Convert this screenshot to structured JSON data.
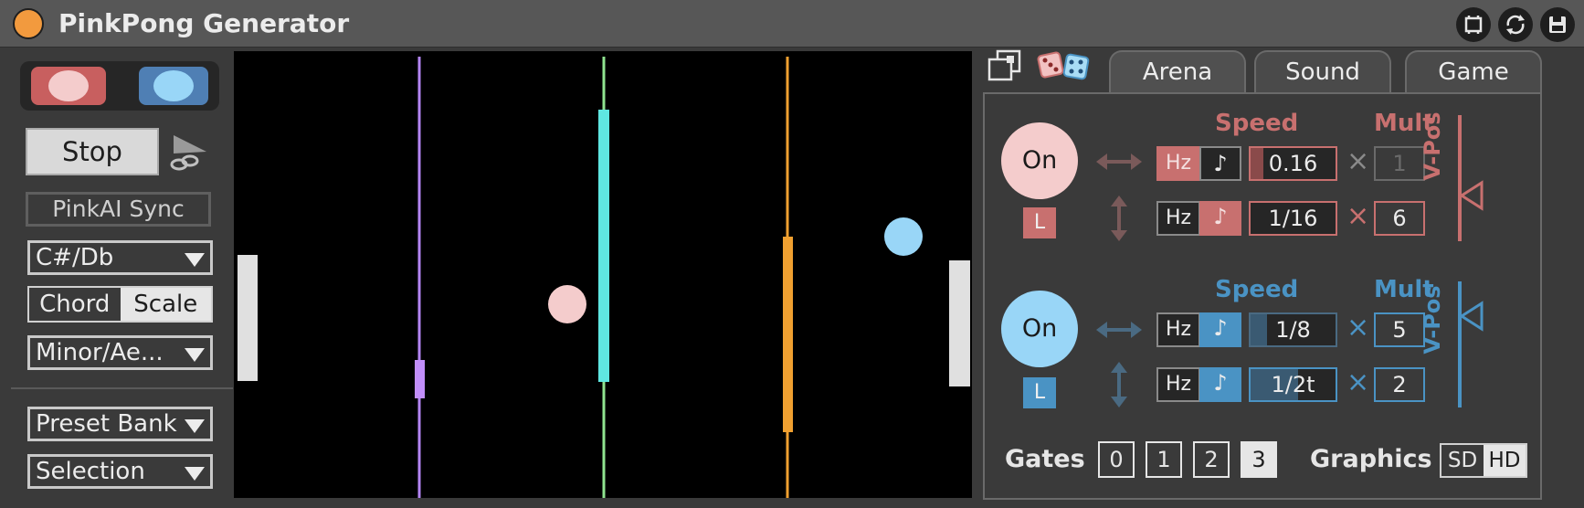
{
  "window": {
    "title": "PinkPong Generator",
    "icons": [
      "display-icon",
      "sync-icon",
      "save-icon"
    ]
  },
  "left": {
    "stop_label": "Stop",
    "sync_label": "PinkAI Sync",
    "key": "C#/Db",
    "mode_options": [
      "Chord",
      "Scale"
    ],
    "mode_selected": "Scale",
    "scale": "Minor/Ae...",
    "preset_bank": "Preset Bank",
    "selection": "Selection"
  },
  "arena": {
    "lines": [
      {
        "color": "#b485f5",
        "fill_color": "#c18ef9"
      },
      {
        "color": "#8fe38f",
        "fill_color": "#5fe6e1"
      },
      {
        "color": "#f0a030",
        "fill_color": "#f0a030"
      }
    ],
    "balls": [
      {
        "color": "#f4cccc"
      },
      {
        "color": "#99d6f7"
      }
    ],
    "paddle_color": "#e0e0e0"
  },
  "tabs": [
    "Arena",
    "Sound",
    "Game"
  ],
  "pink": {
    "color": "#c8706f",
    "on_label": "On",
    "lock_label": "L",
    "speed_header": "Speed",
    "mult_header": "Mult",
    "vpos_label": "V-Pos",
    "h": {
      "hz": "Hz",
      "note": "♪",
      "unit": "Hz",
      "speed": "0.16",
      "x": "×",
      "mult": "1"
    },
    "v": {
      "hz": "Hz",
      "note": "♪",
      "unit": "note",
      "speed": "1/16",
      "x": "×",
      "mult": "6"
    }
  },
  "blue": {
    "color": "#4a93c4",
    "on_label": "On",
    "lock_label": "L",
    "speed_header": "Speed",
    "mult_header": "Mult",
    "vpos_label": "V-Pos",
    "h": {
      "hz": "Hz",
      "note": "♪",
      "unit": "note",
      "speed": "1/8",
      "x": "×",
      "mult": "5"
    },
    "v": {
      "hz": "Hz",
      "note": "♪",
      "unit": "note",
      "speed": "1/2t",
      "x": "×",
      "mult": "2"
    }
  },
  "bottom": {
    "gates_label": "Gates",
    "gates": [
      "0",
      "1",
      "2",
      "3"
    ],
    "gate_selected": "3",
    "graphics_label": "Graphics",
    "graphics_options": [
      "SD",
      "HD"
    ],
    "graphics_selected": "HD"
  }
}
